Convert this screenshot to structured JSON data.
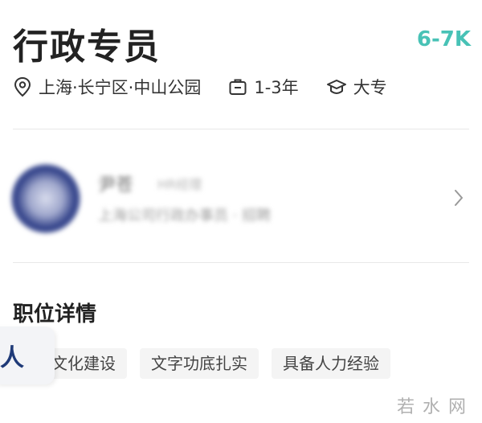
{
  "job": {
    "title": "行政专员",
    "salary": "6-7K",
    "location": "上海·长宁区·中山公园",
    "experience": "1-3年",
    "education": "大专"
  },
  "company": {
    "name": "尹苍",
    "recruiter_title": "HR经理",
    "description": "上海公司行政办事员 · 招聘"
  },
  "section": {
    "title": "职位详情"
  },
  "tags": [
    "文化建设",
    "文字功底扎实",
    "具备人力经验"
  ],
  "floating_card": {
    "label": "人"
  },
  "watermark": "若水网",
  "colors": {
    "salary": "#48c2b6",
    "tag_bg": "#f4f4f4",
    "card_text": "#1f3a78"
  },
  "icons": [
    "location-pin-icon",
    "briefcase-icon",
    "graduation-cap-icon",
    "chevron-right-icon"
  ]
}
